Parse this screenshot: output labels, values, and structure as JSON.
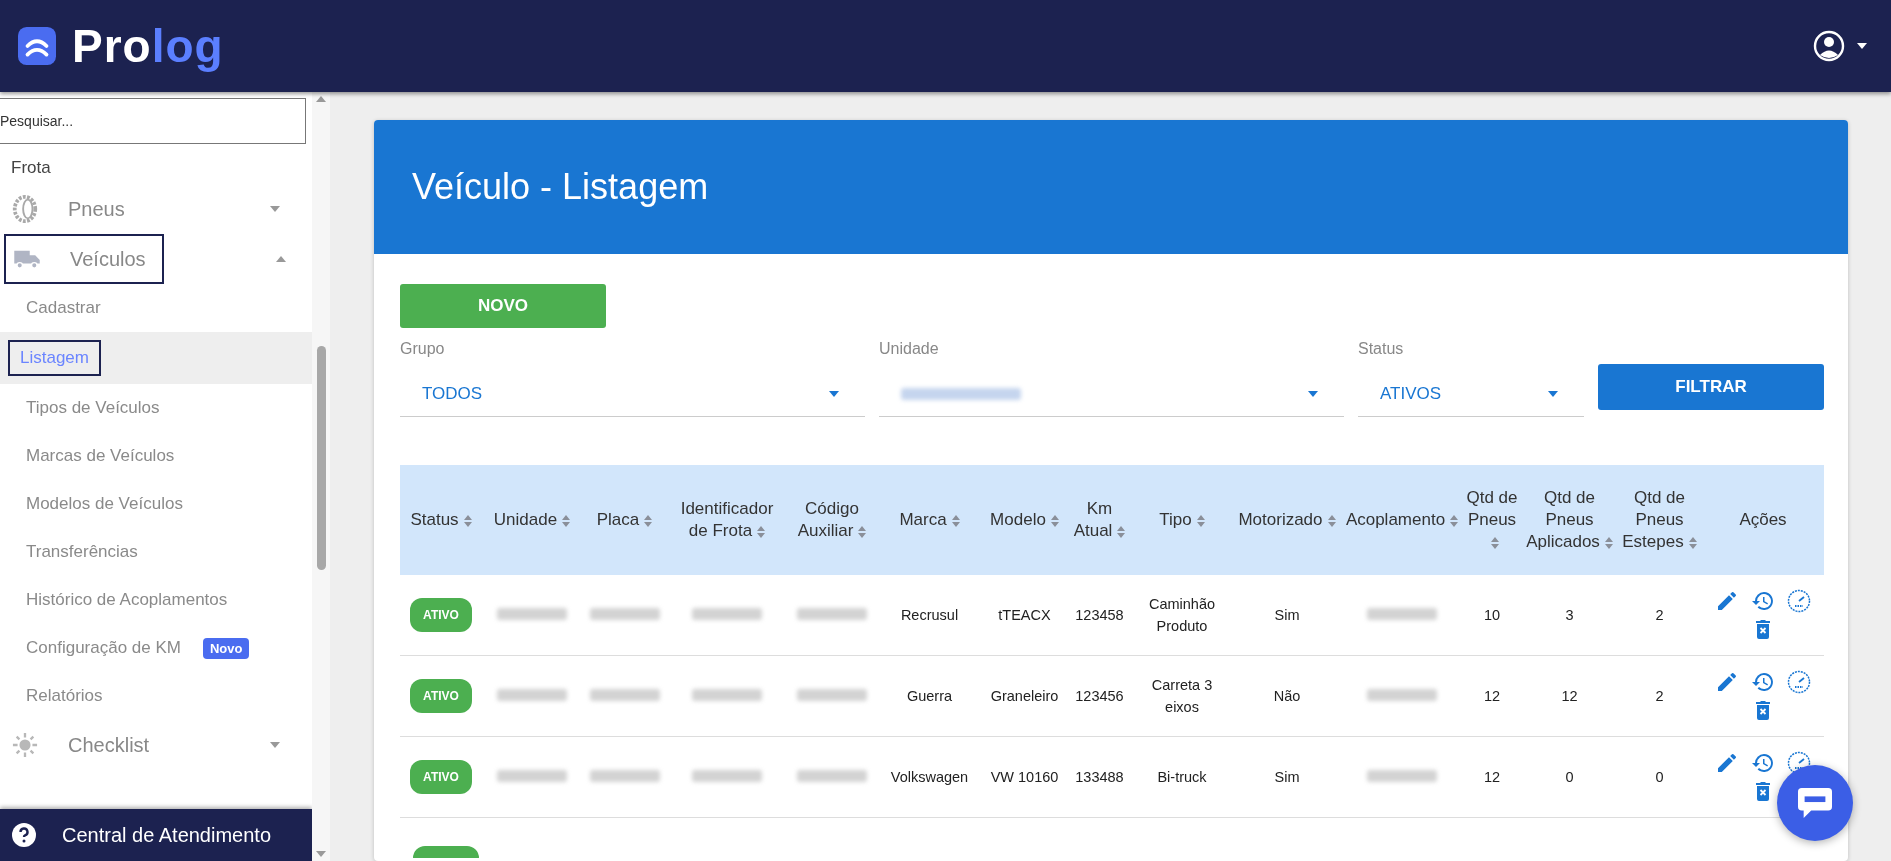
{
  "header": {
    "logo_prefix": "Pro",
    "logo_suffix": "log"
  },
  "sidebar": {
    "search": {
      "placeholder": "Pesquisar..."
    },
    "section": "Frota",
    "groups": [
      {
        "label": "Pneus",
        "kind": "tire",
        "expanded": false,
        "focused": false
      },
      {
        "label": "Veículos",
        "kind": "truck",
        "expanded": true,
        "focused": true,
        "children": [
          {
            "label": "Cadastrar",
            "selected": false,
            "focused": false
          },
          {
            "label": "Listagem",
            "selected": true,
            "focused": true
          },
          {
            "label": "Tipos de Veículos",
            "selected": false,
            "focused": false
          },
          {
            "label": "Marcas de Veículos",
            "selected": false,
            "focused": false
          },
          {
            "label": "Modelos de Veículos",
            "selected": false,
            "focused": false
          },
          {
            "label": "Transferências",
            "selected": false,
            "focused": false
          },
          {
            "label": "Histórico de Acoplamentos",
            "selected": false,
            "focused": false
          },
          {
            "label": "Configuração de KM",
            "selected": false,
            "focused": false,
            "badge": "Novo"
          },
          {
            "label": "Relatórios",
            "selected": false,
            "focused": false
          }
        ]
      },
      {
        "label": "Checklist",
        "kind": "sun",
        "expanded": false,
        "focused": false
      }
    ],
    "help": "Central de Atendimento"
  },
  "page": {
    "title": "Veículo - Listagem",
    "new_button": "NOVO",
    "filters": [
      {
        "label": "Grupo",
        "value": "TODOS",
        "redacted": false
      },
      {
        "label": "Unidade",
        "redacted": true
      },
      {
        "label": "Status",
        "value": "ATIVOS",
        "redacted": false
      }
    ],
    "filter_button": "FILTRAR",
    "table": {
      "columns": [
        {
          "label": "Status",
          "sortable": true
        },
        {
          "label": "Unidade",
          "sortable": true
        },
        {
          "label": "Placa",
          "sortable": true
        },
        {
          "label": "Identificador de Frota",
          "sortable": true
        },
        {
          "label": "Código Auxiliar",
          "sortable": true
        },
        {
          "label": "Marca",
          "sortable": true
        },
        {
          "label": "Modelo",
          "sortable": true
        },
        {
          "label": "Km Atual",
          "sortable": true
        },
        {
          "label": "Tipo",
          "sortable": true
        },
        {
          "label": "Motorizado",
          "sortable": true
        },
        {
          "label": "Acoplamento",
          "sortable": true
        },
        {
          "label": "Qtd de Pneus",
          "sortable": true
        },
        {
          "label": "Qtd de Pneus Aplicados",
          "sortable": true
        },
        {
          "label": "Qtd de Pneus Estepes",
          "sortable": true
        },
        {
          "label": "Ações",
          "sortable": false
        }
      ],
      "rows": [
        {
          "cells": [
            "ATIVO",
            null,
            null,
            null,
            null,
            "Recrusul",
            "tTEACX",
            "123458",
            "Caminhão Produto",
            "Sim",
            null,
            "10",
            "3",
            "2"
          ]
        },
        {
          "cells": [
            "ATIVO",
            null,
            null,
            null,
            null,
            "Guerra",
            "Graneleiro",
            "123456",
            "Carreta 3 eixos",
            "Não",
            null,
            "12",
            "12",
            "2"
          ]
        },
        {
          "cells": [
            "ATIVO",
            null,
            null,
            null,
            null,
            "Volkswagen",
            "VW 10160",
            "133488",
            "Bi-truck",
            "Sim",
            null,
            "12",
            "0",
            "0"
          ]
        }
      ]
    }
  }
}
